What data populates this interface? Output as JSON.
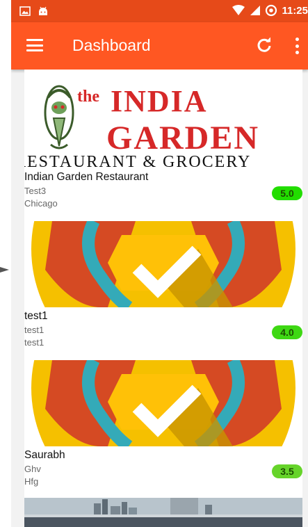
{
  "status_bar": {
    "time": "11:25",
    "icons": [
      "image-icon",
      "android-icon",
      "wifi-icon",
      "signal-icon",
      "alarm-icon"
    ]
  },
  "app_bar": {
    "title": "Dashboard",
    "icons": [
      "hamburger-menu-icon",
      "refresh-icon",
      "overflow-menu-icon"
    ],
    "color": "#ff5722",
    "status_color": "#e64a19"
  },
  "banner_logo": {
    "line1": "the",
    "line2": "INDIA",
    "line3": "GARDEN",
    "line4": "RESTAURANT & GROCERY",
    "color": "#d62828"
  },
  "restaurants": [
    {
      "name": "Indian Garden Restaurant",
      "line1": "Test3",
      "line2": "Chicago",
      "rating": "5.0",
      "rating_color": "#22dd00",
      "image": "india-garden-logo"
    },
    {
      "name": "test1",
      "line1": "test1",
      "line2": "test1",
      "rating": "4.0",
      "rating_color": "#3ed813",
      "image": "checkmark-badge"
    },
    {
      "name": "Saurabh",
      "line1": "Ghv",
      "line2": "Hfg",
      "rating": "3.5",
      "rating_color": "#66d42a",
      "image": "checkmark-badge"
    },
    {
      "name": "",
      "line1": "",
      "line2": "",
      "rating": "",
      "image": "city-skyline-photo"
    }
  ]
}
